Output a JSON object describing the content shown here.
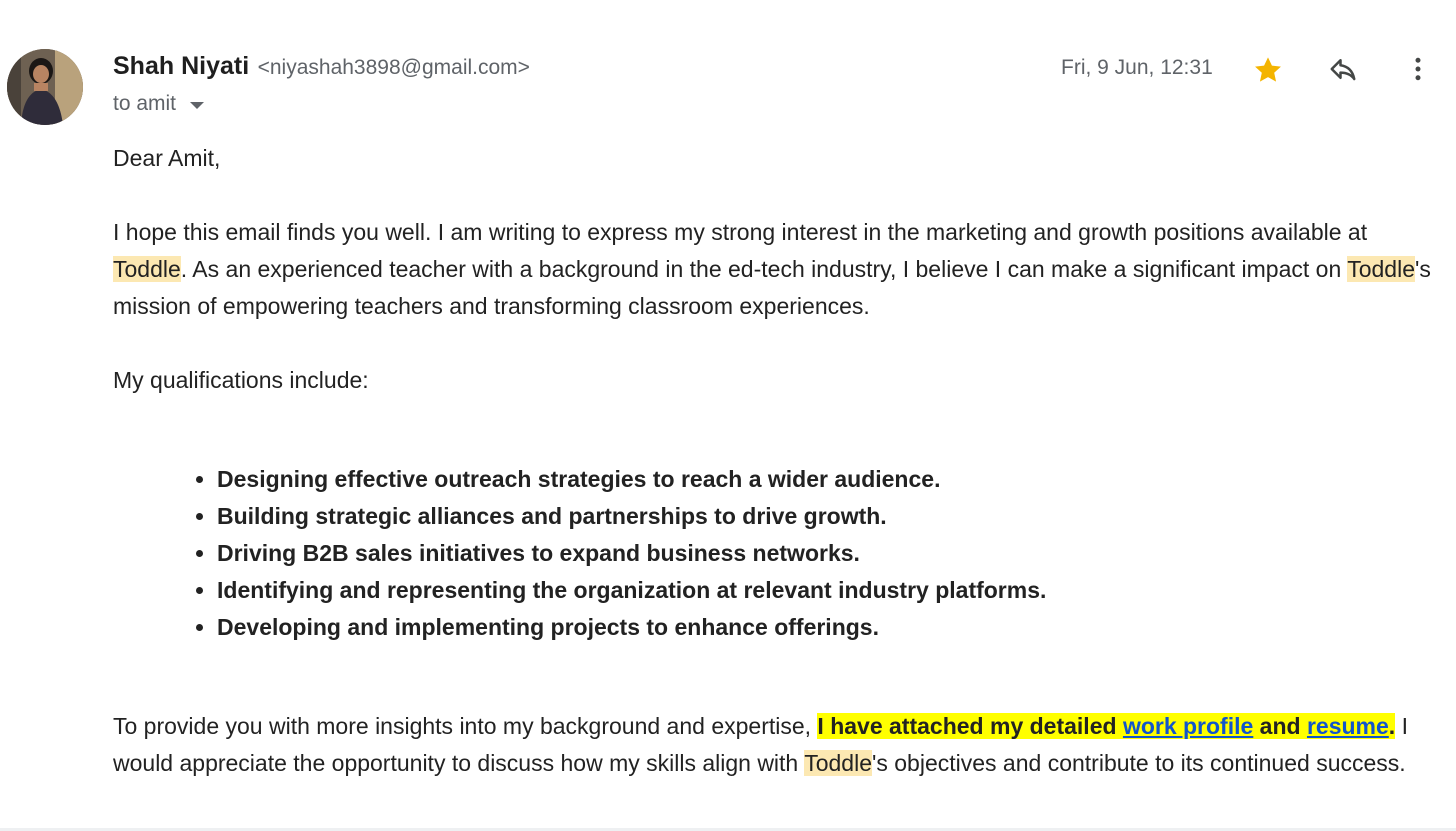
{
  "header": {
    "sender_name": "Shah Niyati",
    "sender_email": "<niyashah3898@gmail.com>",
    "recipient": "to amit",
    "date": "Fri, 9 Jun, 12:31"
  },
  "icons": {
    "star": "star-icon",
    "reply": "reply-icon",
    "more": "more-vert-icon",
    "star_color": "#f4b400",
    "icon_color": "#444746"
  },
  "body": {
    "greeting": "Dear Amit,",
    "p1_a": "I hope this email finds you well. I am writing to express my strong interest in the marketing and growth positions available at ",
    "toddle": "Toddle",
    "p1_b": ". As an experienced teacher with a background in the ed-tech industry, I believe I can make a significant impact on ",
    "p1_c": "'s mission of empowering teachers and transforming classroom experiences.",
    "quals_intro": "My qualifications include:",
    "qualifications": [
      "Designing effective outreach strategies to reach a wider audience.",
      "Building strategic alliances and partnerships to drive growth.",
      "Driving B2B sales initiatives to expand business networks.",
      "Identifying and representing the organization at relevant industry platforms.",
      "Developing and implementing projects to enhance offerings."
    ],
    "p2_a": "To provide you with more insights into my background and expertise, ",
    "p2_hl_a": "I have attached my detailed ",
    "link_work_profile": "work profile",
    "p2_hl_and": " and ",
    "link_resume": "resume",
    "p2_hl_dot": ".",
    "p2_b": "  I would appreciate the opportunity to discuss how my skills align with ",
    "p2_c": "'s objectives and contribute to its continued success."
  },
  "colors": {
    "toddle_highlight": "#fce8b2",
    "yellow_highlight": "#ffff00",
    "link": "#1155cc"
  }
}
